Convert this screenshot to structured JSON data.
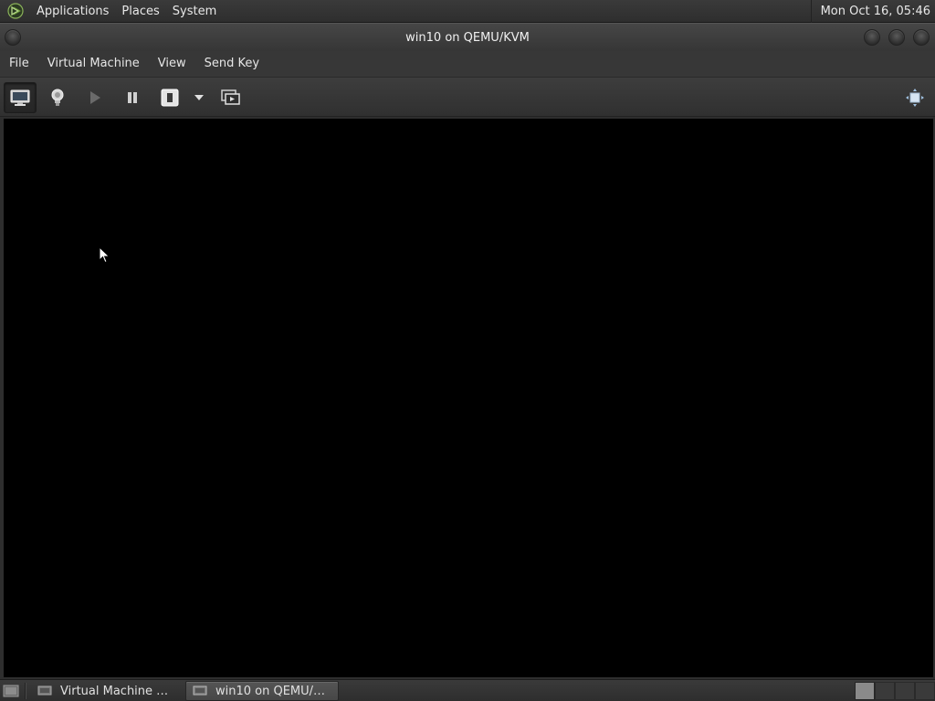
{
  "top_panel": {
    "menus": [
      {
        "label": "Applications"
      },
      {
        "label": "Places"
      },
      {
        "label": "System"
      }
    ],
    "clock": "Mon Oct 16, 05:46",
    "logo_icon": "distro-logo-icon"
  },
  "window": {
    "title": "win10 on QEMU/KVM",
    "controls": [
      "window-menu-icon",
      "minimize-icon",
      "maximize-icon",
      "close-icon"
    ]
  },
  "menubar": {
    "items": [
      {
        "label": "File"
      },
      {
        "label": "Virtual Machine"
      },
      {
        "label": "View"
      },
      {
        "label": "Send Key"
      }
    ]
  },
  "toolbar": {
    "buttons": [
      {
        "icon": "console-monitor-icon",
        "active": true
      },
      {
        "icon": "lightbulb-details-icon",
        "active": false
      },
      {
        "icon": "play-icon",
        "active": false,
        "disabled": true
      },
      {
        "icon": "pause-icon",
        "active": false
      },
      {
        "icon": "power-off-icon",
        "active": false
      },
      {
        "icon": "dropdown-arrow-icon",
        "active": false
      },
      {
        "icon": "snapshots-icon",
        "active": false
      },
      {
        "icon": "fullscreen-icon",
        "active": false
      }
    ]
  },
  "taskbar": {
    "tasks": [
      {
        "label": "Virtual Machine Man…",
        "active": false,
        "icon": "vm-manager-icon"
      },
      {
        "label": "win10 on QEMU/KVM",
        "active": true,
        "icon": "vm-console-icon"
      }
    ],
    "workspaces": 4,
    "current_workspace": 1
  },
  "colors": {
    "panel_bg": "#333333",
    "console_bg": "#000000",
    "text": "#e6e6e6"
  }
}
